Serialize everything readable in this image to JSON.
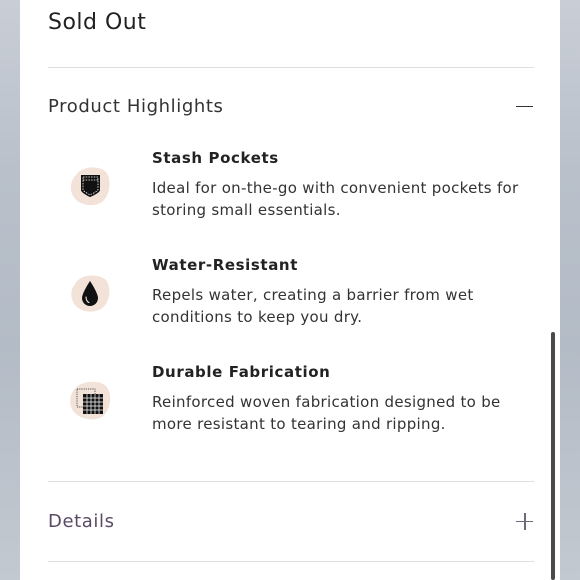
{
  "status": {
    "sold_out_label": "Sold Out"
  },
  "highlights": {
    "title": "Product Highlights",
    "toggle_icon": "minus-icon",
    "features": [
      {
        "title": "Stash Pockets",
        "description": "Ideal for on-the-go with convenient pockets for storing small essentials.",
        "icon": "pocket-icon"
      },
      {
        "title": "Water-Resistant",
        "description": "Repels water, creating a barrier from wet conditions to keep you dry.",
        "icon": "water-drop-icon"
      },
      {
        "title": "Durable Fabrication",
        "description": "Reinforced woven fabrication designed to be more resistant to tearing and ripping.",
        "icon": "woven-fabric-icon"
      }
    ]
  },
  "details": {
    "title": "Details",
    "toggle_icon": "plus-icon"
  },
  "colors": {
    "icon_blob": "#f3e2d8",
    "icon_fill": "#111111",
    "details_title": "#5b4a66"
  }
}
